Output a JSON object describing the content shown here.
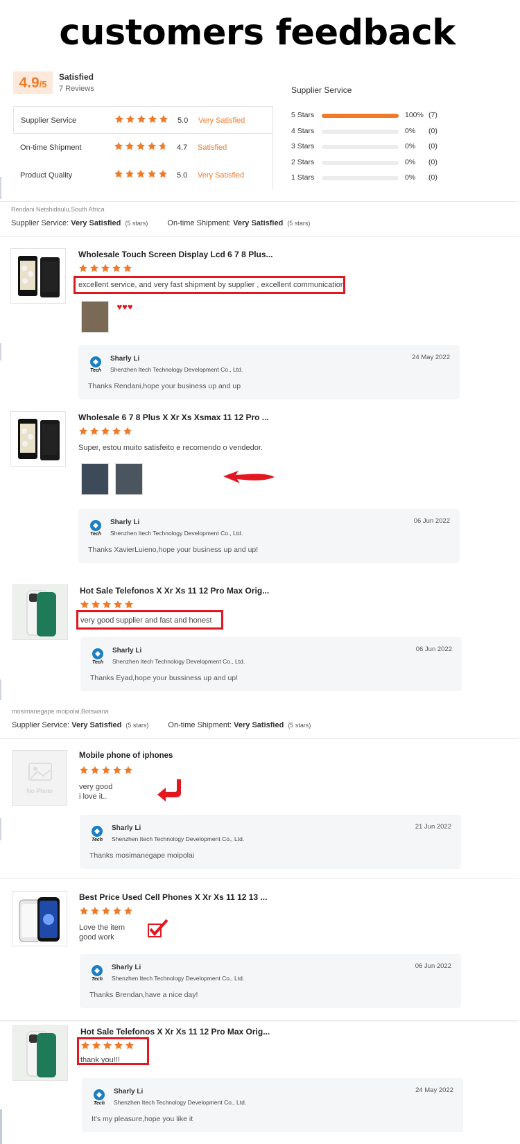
{
  "page_title": "customers feedback",
  "summary": {
    "score": "4.9",
    "score_suffix": "/5",
    "score_word": "Satisfied",
    "review_count": "7 Reviews",
    "metrics": [
      {
        "label": "Supplier Service",
        "stars": 5,
        "value": "5.0",
        "word": "Very Satisfied"
      },
      {
        "label": "On-time Shipment",
        "stars": 4.7,
        "value": "4.7",
        "word": "Satisfied"
      },
      {
        "label": "Product Quality",
        "stars": 5,
        "value": "5.0",
        "word": "Very Satisfied"
      }
    ],
    "distribution_title": "Supplier Service",
    "distribution": [
      {
        "label": "5 Stars",
        "fill": 1.0,
        "pct": "100%",
        "count": "(7)"
      },
      {
        "label": "4 Stars",
        "fill": 0,
        "pct": "0%",
        "count": "(0)"
      },
      {
        "label": "3 Stars",
        "fill": 0,
        "pct": "0%",
        "count": "(0)"
      },
      {
        "label": "2 Stars",
        "fill": 0,
        "pct": "0%",
        "count": "(0)"
      },
      {
        "label": "1 Stars",
        "fill": 0,
        "pct": "0%",
        "count": "(0)"
      }
    ]
  },
  "buyers": [
    {
      "name": "Rendani Netshidaulu,South Africa",
      "service_label": "Supplier Service:",
      "service_value": "Very Satisfied",
      "service_stars": "(5 stars)",
      "shipment_label": "On-time Shipment:",
      "shipment_value": "Very Satisfied",
      "shipment_stars": "(5 stars)"
    },
    {
      "name": "mosimanegape moipolai,Botswana",
      "service_label": "Supplier Service:",
      "service_value": "Very Satisfied",
      "service_stars": "(5 stars)",
      "shipment_label": "On-time Shipment:",
      "shipment_value": "Very Satisfied",
      "shipment_stars": "(5 stars)"
    }
  ],
  "reviews": [
    {
      "product": "Wholesale Touch Screen Display Lcd 6 7 8 Plus...",
      "text": "excellent service, and very fast shipment by supplier , excellent communication",
      "photo_extra": "♥♥♥",
      "reply": {
        "name": "Sharly Li",
        "company": "Shenzhen Itech Technology Development Co., Ltd.",
        "date": "24 May 2022",
        "message": "Thanks Rendani,hope your business up and up"
      }
    },
    {
      "product": "Wholesale 6 7 8 Plus X Xr Xs Xsmax 11 12 Pro ...",
      "text": "Super, estou muito satisfeito e recomendo o vendedor.",
      "reply": {
        "name": "Sharly Li",
        "company": "Shenzhen Itech Technology Development Co., Ltd.",
        "date": "06 Jun 2022",
        "message": "Thanks XavierLuieno,hope your business up and up!"
      }
    },
    {
      "product": "Hot Sale Telefonos X Xr Xs 11 12 Pro Max Orig...",
      "text": "very good supplier and fast and honest",
      "reply": {
        "name": "Sharly Li",
        "company": "Shenzhen Itech Technology Development Co., Ltd.",
        "date": "06 Jun 2022",
        "message": "Thanks Eyad,hope your bussiness up and up!"
      }
    },
    {
      "product": "Mobile phone of iphones",
      "text": "very good\ni love it..",
      "thumb_text": "No Photo",
      "reply": {
        "name": "Sharly Li",
        "company": "Shenzhen Itech Technology Development Co., Ltd.",
        "date": "21 Jun 2022",
        "message": "Thanks mosimanegape moipolai"
      }
    },
    {
      "product": "Best Price Used Cell Phones X Xr Xs 11 12 13 ...",
      "text": "Love the item\ngood work",
      "reply": {
        "name": "Sharly Li",
        "company": "Shenzhen Itech Technology Development Co., Ltd.",
        "date": "06 Jun 2022",
        "message": "Thanks Brendan,have a nice day!"
      }
    },
    {
      "product": "Hot Sale Telefonos X Xr Xs 11 12 Pro Max Orig...",
      "text": "thank you!!!",
      "reply": {
        "name": "Sharly Li",
        "company": "Shenzhen Itech Technology Development Co., Ltd.",
        "date": "24 May 2022",
        "message": "It's my pleasure,hope you like it"
      }
    }
  ],
  "colors": {
    "accent": "#f07a27",
    "annotation_red": "#e4161e",
    "reply_bg": "#f5f6f8"
  },
  "icons": [
    "star-icon",
    "itech-logo-icon",
    "heart-icon",
    "red-arrow-icon",
    "checkmark-icon"
  ]
}
